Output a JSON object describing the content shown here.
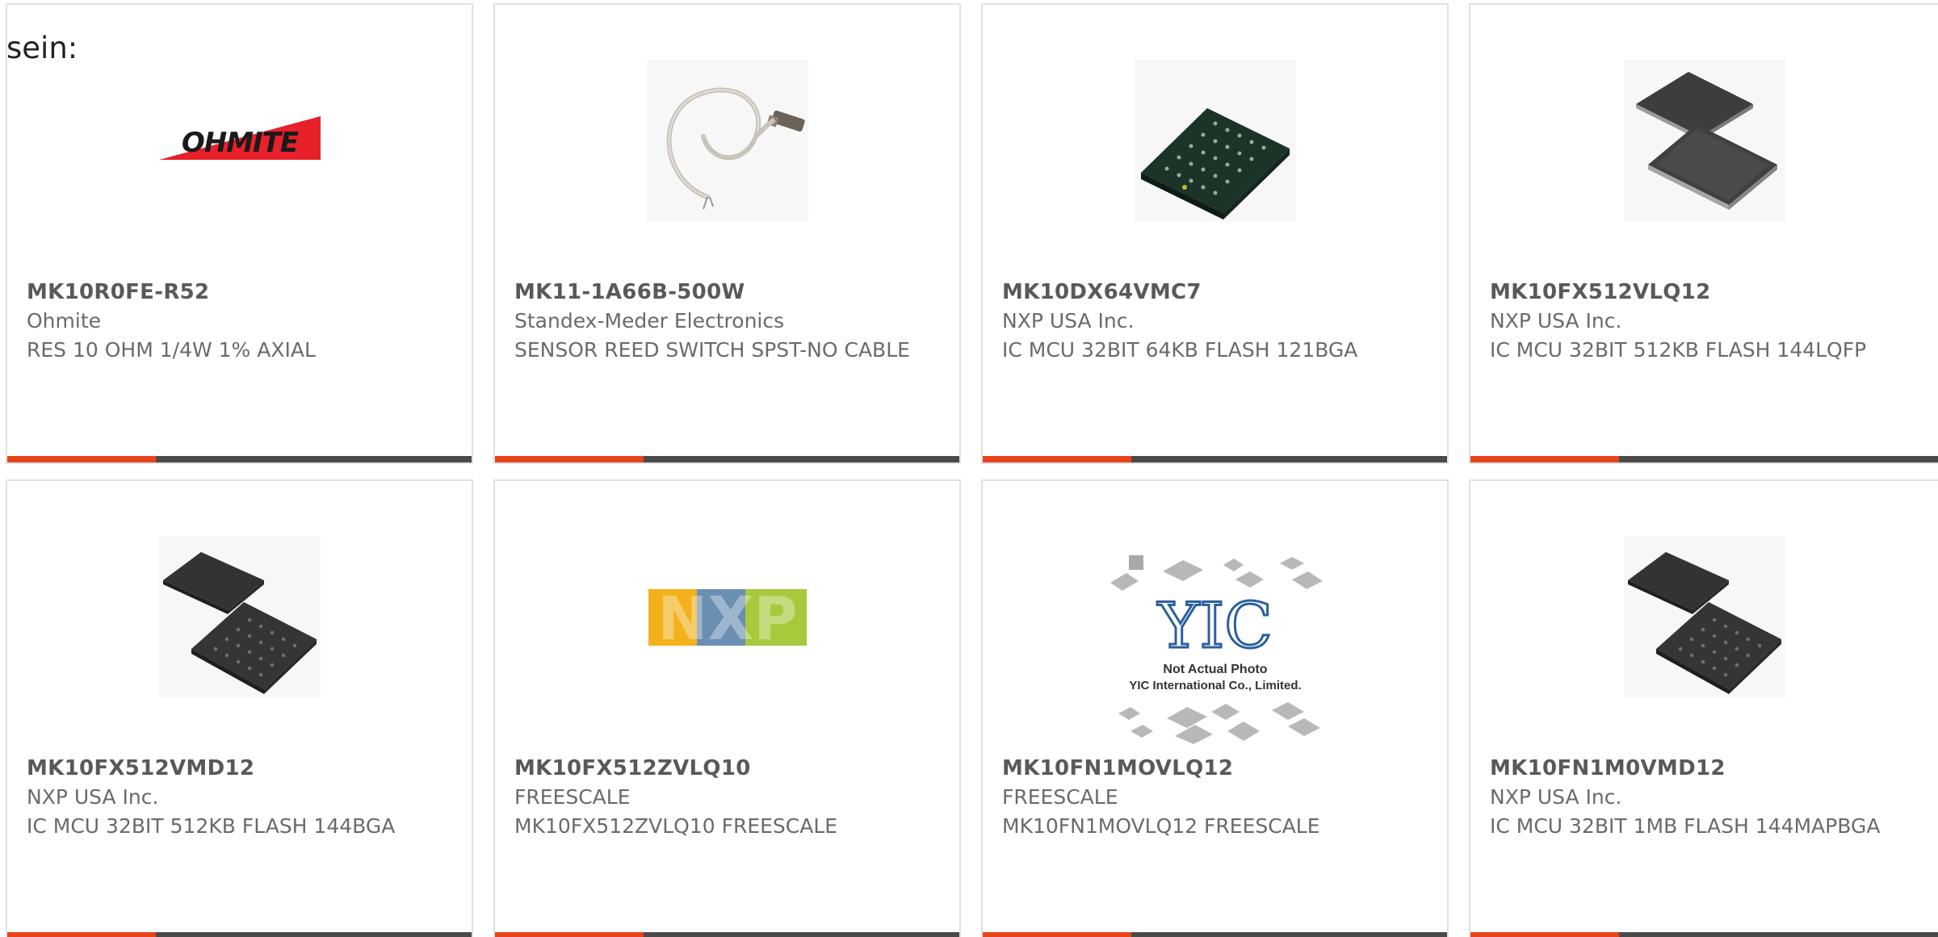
{
  "heading": "sein:",
  "colors": {
    "accent": "#e8441c",
    "bar": "#4a4a4a",
    "text_primary": "#595959",
    "text_secondary": "#6a6a6a",
    "card_border": "#e1e1e1"
  },
  "products": [
    {
      "part_number": "MK10R0FE-R52",
      "manufacturer": "Ohmite",
      "description": "RES 10 OHM 1/4W 1% AXIAL",
      "image_icon": "ohmite-logo-icon",
      "logo_text": "OHMITE"
    },
    {
      "part_number": "MK11-1A66B-500W",
      "manufacturer": "Standex-Meder Electronics",
      "description": "SENSOR REED SWITCH SPST-NO CABLE",
      "image_icon": "reed-sensor-cable-icon"
    },
    {
      "part_number": "MK10DX64VMC7",
      "manufacturer": "NXP USA Inc.",
      "description": "IC MCU 32BIT 64KB FLASH 121BGA",
      "image_icon": "bga-chip-icon"
    },
    {
      "part_number": "MK10FX512VLQ12",
      "manufacturer": "NXP USA Inc.",
      "description": "IC MCU 32BIT 512KB FLASH 144LQFP",
      "image_icon": "lqfp-chip-icon"
    },
    {
      "part_number": "MK10FX512VMD12",
      "manufacturer": "NXP USA Inc.",
      "description": "IC MCU 32BIT 512KB FLASH 144BGA",
      "image_icon": "bga-chip-pair-icon"
    },
    {
      "part_number": "MK10FX512ZVLQ10",
      "manufacturer": "FREESCALE",
      "description": "MK10FX512ZVLQ10 FREESCALE",
      "image_icon": "nxp-logo-icon",
      "logo_text": "NXP"
    },
    {
      "part_number": "MK10FN1MOVLQ12",
      "manufacturer": "FREESCALE",
      "description": "MK10FN1MOVLQ12 FREESCALE",
      "image_icon": "yic-placeholder-icon",
      "logo_text": "YIC",
      "photo_note_1": "Not Actual Photo",
      "photo_note_2": "YIC International Co., Limited."
    },
    {
      "part_number": "MK10FN1M0VMD12",
      "manufacturer": "NXP USA Inc.",
      "description": "IC MCU 32BIT 1MB FLASH 144MAPBGA",
      "image_icon": "bga-chip-pair-icon"
    }
  ]
}
